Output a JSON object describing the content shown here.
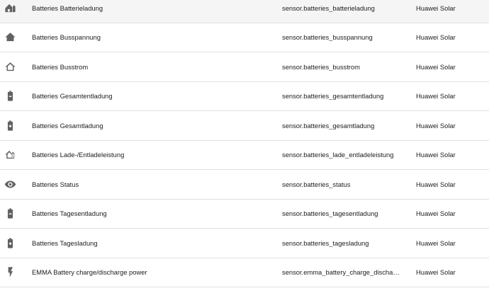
{
  "rows": [
    {
      "icon": "battery-home-charging-icon",
      "name": "Batteries Batterieladung",
      "entity_id": "sensor.batteries_batterieladung",
      "integration": "Huawei Solar"
    },
    {
      "icon": "home-filled-icon",
      "name": "Batteries Busspannung",
      "entity_id": "sensor.batteries_busspannung",
      "integration": "Huawei Solar"
    },
    {
      "icon": "home-outline-icon",
      "name": "Batteries Busstrom",
      "entity_id": "sensor.batteries_busstrom",
      "integration": "Huawei Solar"
    },
    {
      "icon": "battery-minus-icon",
      "name": "Batteries Gesamtentladung",
      "entity_id": "sensor.batteries_gesamtentladung",
      "integration": "Huawei Solar"
    },
    {
      "icon": "battery-plus-icon",
      "name": "Batteries Gesamtladung",
      "entity_id": "sensor.batteries_gesamtladung",
      "integration": "Huawei Solar"
    },
    {
      "icon": "home-battery-icon",
      "name": "Batteries Lade-/Entladeleistung",
      "entity_id": "sensor.batteries_lade_entladeleistung",
      "integration": "Huawei Solar"
    },
    {
      "icon": "eye-icon",
      "name": "Batteries Status",
      "entity_id": "sensor.batteries_status",
      "integration": "Huawei Solar"
    },
    {
      "icon": "battery-minus-icon",
      "name": "Batteries Tagesentladung",
      "entity_id": "sensor.batteries_tagesentladung",
      "integration": "Huawei Solar"
    },
    {
      "icon": "battery-plus-icon",
      "name": "Batteries Tagesladung",
      "entity_id": "sensor.batteries_tagesladung",
      "integration": "Huawei Solar"
    },
    {
      "icon": "flash-icon",
      "name": "EMMA Battery charge/discharge power",
      "entity_id": "sensor.emma_battery_charge_discharge...",
      "integration": "Huawei Solar"
    }
  ]
}
